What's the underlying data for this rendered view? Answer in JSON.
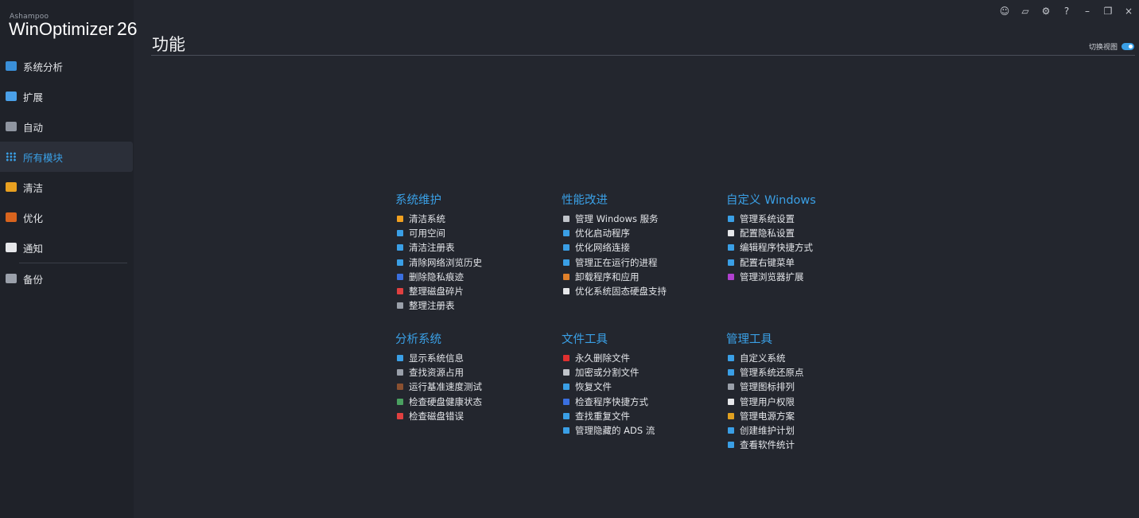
{
  "app": {
    "vendor": "Ashampoo",
    "name": "WinOptimizer",
    "version": "26"
  },
  "titlebar": {
    "buttons": [
      {
        "name": "feedback-icon",
        "glyph": "☺"
      },
      {
        "name": "news-icon",
        "glyph": "▱"
      },
      {
        "name": "settings-icon",
        "glyph": "⚙"
      },
      {
        "name": "help-icon",
        "glyph": "?"
      },
      {
        "name": "minimize-icon",
        "glyph": "–"
      },
      {
        "name": "maximize-icon",
        "glyph": "❐"
      },
      {
        "name": "close-icon",
        "glyph": "×"
      }
    ]
  },
  "sidebar": {
    "items": [
      {
        "label": "系统分析",
        "icon": "monitor-icon",
        "color": "#3a8fd8",
        "active": false
      },
      {
        "label": "扩展",
        "icon": "chart-icon",
        "color": "#4aa0e8",
        "active": false
      },
      {
        "label": "自动",
        "icon": "auto-icon",
        "color": "#8f95a0",
        "active": false
      },
      {
        "label": "所有模块",
        "icon": "grid-icon",
        "color": "#3aa0e6",
        "active": true
      },
      {
        "label": "清洁",
        "icon": "broom-icon",
        "color": "#e8a020",
        "active": false
      },
      {
        "label": "优化",
        "icon": "gauge-icon",
        "color": "#d8641e",
        "active": false
      },
      {
        "label": "通知",
        "icon": "checkbox-icon",
        "color": "#e6e7ea",
        "active": false
      },
      {
        "label": "备份",
        "icon": "drive-icon",
        "color": "#9aa0aa",
        "active": false
      }
    ]
  },
  "main": {
    "title": "功能",
    "view_toggle_label": "切换视图",
    "view_toggle_on": true,
    "groups": [
      {
        "title": "系统维护",
        "items": [
          {
            "label": "清洁系统",
            "icon": "broom-icon",
            "color": "#f0a020"
          },
          {
            "label": "可用空间",
            "icon": "document-icon",
            "color": "#3a9fe6"
          },
          {
            "label": "清洁注册表",
            "icon": "registry-icon",
            "color": "#3a9fe6"
          },
          {
            "label": "清除网络浏览历史",
            "icon": "globe-icon",
            "color": "#3a9fe6"
          },
          {
            "label": "删除隐私痕迹",
            "icon": "shield-icon",
            "color": "#3a6fe0"
          },
          {
            "label": "整理磁盘碎片",
            "icon": "defrag-icon",
            "color": "#e04040"
          },
          {
            "label": "整理注册表",
            "icon": "registry-defrag-icon",
            "color": "#9aa0aa"
          }
        ]
      },
      {
        "title": "性能改进",
        "items": [
          {
            "label": "管理 Windows 服务",
            "icon": "gears-icon",
            "color": "#c0c4ca"
          },
          {
            "label": "优化启动程序",
            "icon": "startup-icon",
            "color": "#3a9fe6"
          },
          {
            "label": "优化网络连接",
            "icon": "network-icon",
            "color": "#3a9fe6"
          },
          {
            "label": "管理正在运行的进程",
            "icon": "process-icon",
            "color": "#3a9fe6"
          },
          {
            "label": "卸载程序和应用",
            "icon": "uninstall-icon",
            "color": "#e0802a"
          },
          {
            "label": "优化系统固态硬盘支持",
            "icon": "ssd-icon",
            "color": "#e6e7ea"
          }
        ]
      },
      {
        "title": "自定义 Windows",
        "items": [
          {
            "label": "管理系统设置",
            "icon": "settings-window-icon",
            "color": "#3a9fe6"
          },
          {
            "label": "配置隐私设置",
            "icon": "privacy-shield-icon",
            "color": "#e6e7ea"
          },
          {
            "label": "编辑程序快捷方式",
            "icon": "shortcut-icon",
            "color": "#3a9fe6"
          },
          {
            "label": "配置右键菜单",
            "icon": "context-menu-icon",
            "color": "#3a9fe6"
          },
          {
            "label": "管理浏览器扩展",
            "icon": "extension-icon",
            "color": "#b040d0"
          }
        ]
      },
      {
        "title": "分析系统",
        "items": [
          {
            "label": "显示系统信息",
            "icon": "sysinfo-icon",
            "color": "#3a9fe6"
          },
          {
            "label": "查找资源占用",
            "icon": "resource-icon",
            "color": "#9aa0aa"
          },
          {
            "label": "运行基准速度测试",
            "icon": "benchmark-icon",
            "color": "#8a5030"
          },
          {
            "label": "检查硬盘健康状态",
            "icon": "disk-health-icon",
            "color": "#4aa060"
          },
          {
            "label": "检查磁盘错误",
            "icon": "disk-error-icon",
            "color": "#e04040"
          }
        ]
      },
      {
        "title": "文件工具",
        "items": [
          {
            "label": "永久删除文件",
            "icon": "shredder-icon",
            "color": "#e03030"
          },
          {
            "label": "加密或分割文件",
            "icon": "encrypt-icon",
            "color": "#c0c4ca"
          },
          {
            "label": "恢复文件",
            "icon": "restore-file-icon",
            "color": "#3a9fe6"
          },
          {
            "label": "检查程序快捷方式",
            "icon": "link-check-icon",
            "color": "#3a6fe0"
          },
          {
            "label": "查找重复文件",
            "icon": "duplicate-icon",
            "color": "#3a9fe6"
          },
          {
            "label": "管理隐藏的 ADS 流",
            "icon": "ads-icon",
            "color": "#3a9fe6"
          }
        ]
      },
      {
        "title": "管理工具",
        "items": [
          {
            "label": "自定义系统",
            "icon": "customize-icon",
            "color": "#3a9fe6"
          },
          {
            "label": "管理系统还原点",
            "icon": "restore-point-icon",
            "color": "#3a9fe6"
          },
          {
            "label": "管理图标排列",
            "icon": "icon-layout-icon",
            "color": "#9aa0aa"
          },
          {
            "label": "管理用户权限",
            "icon": "user-rights-icon",
            "color": "#e6e7ea"
          },
          {
            "label": "管理电源方案",
            "icon": "battery-icon",
            "color": "#e0a020"
          },
          {
            "label": "创建维护计划",
            "icon": "schedule-icon",
            "color": "#3a9fe6"
          },
          {
            "label": "查看软件统计",
            "icon": "stats-icon",
            "color": "#3a9fe6"
          }
        ]
      }
    ]
  }
}
